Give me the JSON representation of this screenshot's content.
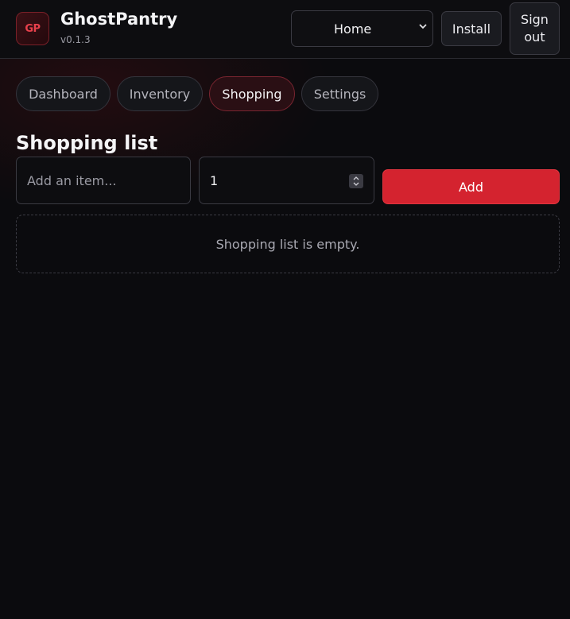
{
  "app": {
    "logo_text": "GP",
    "name": "GhostPantry",
    "version": "v0.1.3"
  },
  "header": {
    "household_select": {
      "selected": "Home"
    },
    "install_label": "Install",
    "signout_label": "Sign out"
  },
  "tabs": [
    {
      "label": "Dashboard",
      "active": false
    },
    {
      "label": "Inventory",
      "active": false
    },
    {
      "label": "Shopping",
      "active": true
    },
    {
      "label": "Settings",
      "active": false
    }
  ],
  "shopping": {
    "title": "Shopping list",
    "item_placeholder": "Add an item...",
    "quantity_value": "1",
    "add_label": "Add",
    "empty_message": "Shopping list is empty."
  },
  "colors": {
    "accent": "#d4232f",
    "background": "#0b0b0e"
  }
}
